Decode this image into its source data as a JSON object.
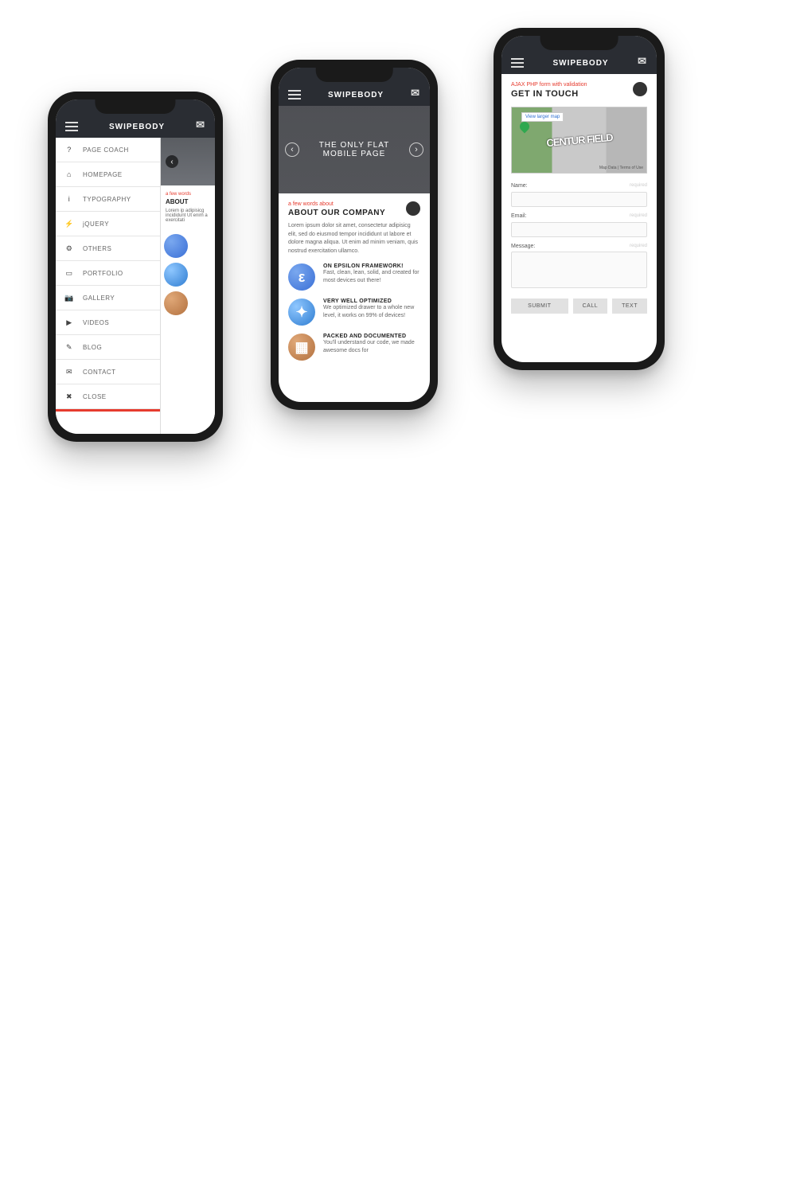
{
  "app_title": "SWIPEBODY",
  "phone1": {
    "menu": [
      {
        "icon": "?",
        "label": "PAGE COACH"
      },
      {
        "icon": "⌂",
        "label": "HOMEPAGE"
      },
      {
        "icon": "i",
        "label": "TYPOGRAPHY"
      },
      {
        "icon": "⚡",
        "label": "jQUERY"
      },
      {
        "icon": "⚙",
        "label": "OTHERS"
      },
      {
        "icon": "▭",
        "label": "PORTFOLIO"
      },
      {
        "icon": "📷",
        "label": "GALLERY"
      },
      {
        "icon": "▶",
        "label": "VIDEOS"
      },
      {
        "icon": "✎",
        "label": "BLOG"
      },
      {
        "icon": "✉",
        "label": "CONTACT"
      },
      {
        "icon": "✖",
        "label": "CLOSE"
      }
    ],
    "behind": {
      "tag": "a few words",
      "hd": "ABOUT",
      "body": "Lorem ip adipisicg incididunt Ut enim a exercitati"
    }
  },
  "phone2": {
    "hero": {
      "line1": "THE ONLY FLAT",
      "line2": "MOBILE PAGE"
    },
    "tag": "a few words about",
    "hd": "ABOUT OUR COMPANY",
    "para": "Lorem ipsum dolor sit amet, consectetur adipisicg elit, sed do eiusmod tempor incididunt ut labore et dolore magna aliqua. Ut enim ad minim veniam, quis nostrud exercitation ullamco.",
    "features": [
      {
        "hd": "ON EPSILON FRAMEWORK!",
        "body": "Fast, clean, lean, solid, and created for most devices out there!"
      },
      {
        "hd": "VERY WELL OPTIMIZED",
        "body": "We optimized drawer to a whole new level, it works on 99% of devices!"
      },
      {
        "hd": "PACKED AND DOCUMENTED",
        "body": "You'll understand our code, we made awesome docs for"
      }
    ]
  },
  "phone3": {
    "tag": "AJAX PHP form with validation",
    "hd": "GET IN TOUCH",
    "map": {
      "badge": "View larger map",
      "sign": "CENTUR FIELD",
      "foot": "Map Data | Terms of Use"
    },
    "fields": {
      "name": {
        "label": "Name:",
        "req": "required"
      },
      "email": {
        "label": "Email:",
        "req": "required"
      },
      "message": {
        "label": "Message:",
        "req": "required"
      }
    },
    "buttons": {
      "submit": "SUBMIT",
      "call": "CALL",
      "text": "TEXT"
    }
  }
}
